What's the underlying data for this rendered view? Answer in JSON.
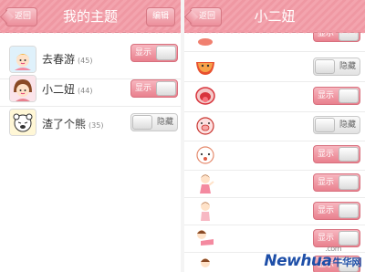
{
  "left": {
    "header": {
      "back": "返回",
      "title": "我的主题",
      "edit": "编辑"
    },
    "themes": [
      {
        "name": "去春游",
        "count": "(45)",
        "state": "显示"
      },
      {
        "name": "小二妞",
        "count": "(44)",
        "state": "显示"
      },
      {
        "name": "渣了个熊",
        "count": "(35)",
        "state": "隐藏"
      }
    ]
  },
  "right": {
    "header": {
      "back": "返回",
      "title": "小二妞"
    },
    "items": [
      {
        "icon": "girl-partial-icon",
        "state": "显示"
      },
      {
        "icon": "watermelon-face-icon",
        "state": "隐藏"
      },
      {
        "icon": "tongue-out-face-icon",
        "state": "显示"
      },
      {
        "icon": "pig-face-icon",
        "state": "隐藏"
      },
      {
        "icon": "round-face-icon",
        "state": "显示"
      },
      {
        "icon": "girl-waving-icon",
        "state": "显示"
      },
      {
        "icon": "girl-standing-icon",
        "state": "显示"
      },
      {
        "icon": "girl-lying-icon",
        "state": "显示"
      },
      {
        "icon": "girl-peeking-icon",
        "state": "显示"
      }
    ]
  },
  "watermark": {
    "brand": "Newhua",
    "cn": "牛华网",
    "domain": ".com"
  },
  "colors": {
    "accent": "#ef98a3",
    "toggle_on": "#e9808e",
    "watermark": "#1e4fa8"
  }
}
